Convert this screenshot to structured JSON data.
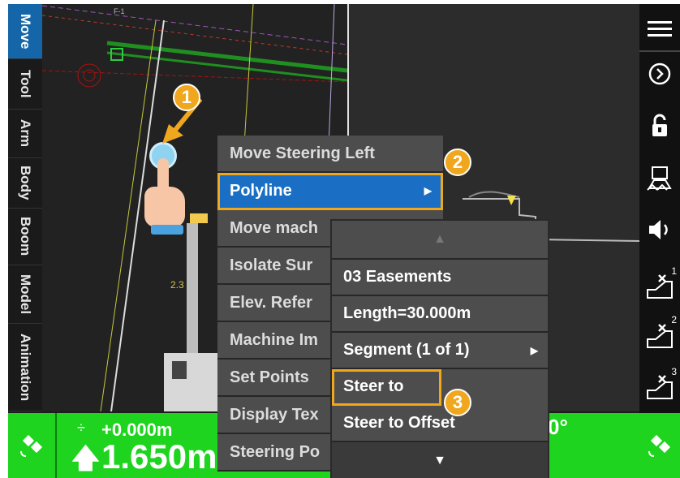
{
  "tabs": [
    "Move",
    "Tool",
    "Arm",
    "Body",
    "Boom",
    "Model",
    "Animation"
  ],
  "active_tab": "Move",
  "map": {
    "grid_label": "F-1",
    "dim_label": "2.3"
  },
  "context_menu": {
    "items": [
      {
        "label": "Move Steering Left"
      },
      {
        "label": "Polyline"
      },
      {
        "label": "Move mach"
      },
      {
        "label": "Isolate Sur"
      },
      {
        "label": "Elev. Refer"
      },
      {
        "label": "Machine Im"
      },
      {
        "label": "Set Points"
      },
      {
        "label": "Display Tex"
      },
      {
        "label": "Steering Po"
      }
    ]
  },
  "submenu": {
    "items": [
      {
        "label": "03 Easements"
      },
      {
        "label": "Length=30.000m"
      },
      {
        "label": "Segment (1 of 1)"
      },
      {
        "label": "Steer to"
      },
      {
        "label": "Steer to Offset"
      }
    ]
  },
  "badges": [
    "1",
    "2",
    "3"
  ],
  "bottom": {
    "cut_fill": "+0.000m",
    "elevation": "1.650m",
    "degree": "0°"
  },
  "right_icons": [
    "menu-icon",
    "next-icon",
    "lock-icon",
    "machine-icon",
    "speaker-icon",
    "design-1-icon",
    "design-2-icon",
    "design-3-icon",
    "gps-icon"
  ],
  "right_sup": [
    "1",
    "2",
    "3"
  ],
  "colors": {
    "selection": "#1a6fc4",
    "highlight": "#f0a71e",
    "status_green": "#1ed41e"
  }
}
